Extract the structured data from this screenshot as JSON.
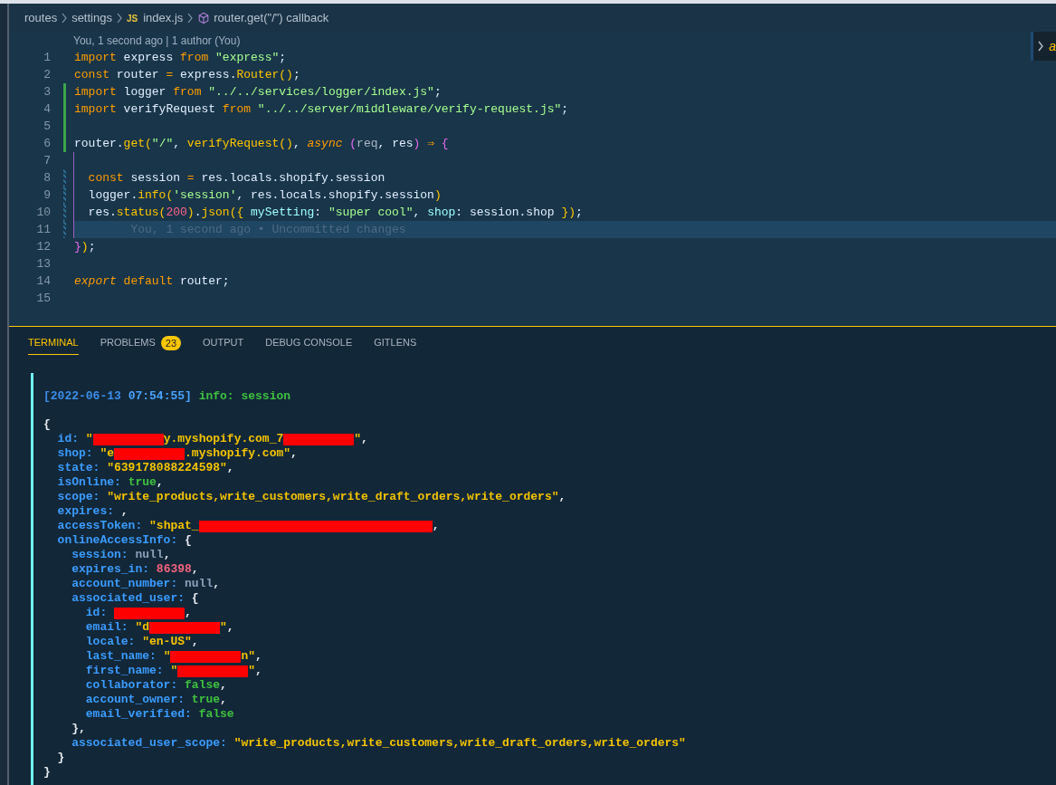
{
  "breadcrumbs": {
    "items": [
      {
        "label": "routes",
        "kind": "folder"
      },
      {
        "label": "settings",
        "kind": "folder"
      },
      {
        "label": "index.js",
        "kind": "file",
        "icon_label": "JS"
      },
      {
        "label": "router.get(\"/\") callback",
        "kind": "symbol"
      }
    ]
  },
  "peek": {
    "text": "a"
  },
  "editor": {
    "codelens": "You, 1 second ago | 1 author (You)",
    "lines": [
      {
        "number": "1",
        "tokens": [
          {
            "text": "import",
            "kind": "kw"
          },
          {
            "text": " express ",
            "kind": "id"
          },
          {
            "text": "from",
            "kind": "kw"
          },
          {
            "text": " \"express\"",
            "kind": "str"
          },
          {
            "text": ";",
            "kind": "punc"
          }
        ]
      },
      {
        "number": "2",
        "tokens": [
          {
            "text": "const",
            "kind": "kw"
          },
          {
            "text": " router ",
            "kind": "id"
          },
          {
            "text": "=",
            "kind": "kw"
          },
          {
            "text": " express.",
            "kind": "id"
          },
          {
            "text": "Router()",
            "kind": "fn"
          },
          {
            "text": ";",
            "kind": "punc"
          }
        ]
      },
      {
        "number": "3",
        "added": true,
        "tokens": [
          {
            "text": "import",
            "kind": "kw"
          },
          {
            "text": " logger ",
            "kind": "id"
          },
          {
            "text": "from",
            "kind": "kw"
          },
          {
            "text": " \"../../services/logger/index.js\"",
            "kind": "str"
          },
          {
            "text": ";",
            "kind": "punc"
          }
        ]
      },
      {
        "number": "4",
        "added": true,
        "tokens": [
          {
            "text": "import",
            "kind": "kw"
          },
          {
            "text": " verifyRequest ",
            "kind": "id"
          },
          {
            "text": "from",
            "kind": "kw"
          },
          {
            "text": " \"../../server/middleware/verify-request.js\"",
            "kind": "str"
          },
          {
            "text": ";",
            "kind": "punc"
          }
        ]
      },
      {
        "number": "5",
        "added": true
      },
      {
        "number": "6",
        "added": true,
        "tokens": [
          {
            "text": "router.",
            "kind": "id"
          },
          {
            "text": "get(",
            "kind": "fn"
          },
          {
            "text": "\"/\"",
            "kind": "str"
          },
          {
            "text": ", ",
            "kind": "punc"
          },
          {
            "text": "verifyRequest()",
            "kind": "fn"
          },
          {
            "text": ", ",
            "kind": "punc"
          },
          {
            "text": "async ",
            "kind": "italic"
          },
          {
            "text": "(",
            "kind": "bracket"
          },
          {
            "text": "req",
            "kind": "param"
          },
          {
            "text": ", ",
            "kind": "punc"
          },
          {
            "text": "res",
            "kind": "id"
          },
          {
            "text": ")",
            "kind": "bracket"
          },
          {
            "text": " ⇒ ",
            "kind": "kw"
          },
          {
            "text": "{",
            "kind": "bracket"
          }
        ]
      },
      {
        "number": "7",
        "scope": true
      },
      {
        "number": "8",
        "scope": true,
        "modified": true,
        "tokens": [
          {
            "text": "  const",
            "kind": "kw"
          },
          {
            "text": " session ",
            "kind": "id"
          },
          {
            "text": "=",
            "kind": "kw"
          },
          {
            "text": " res.locals.shopify.session",
            "kind": "id"
          }
        ]
      },
      {
        "number": "9",
        "scope": true,
        "modified": true,
        "tokens": [
          {
            "text": "  logger.",
            "kind": "id"
          },
          {
            "text": "info(",
            "kind": "fn"
          },
          {
            "text": "'session'",
            "kind": "str"
          },
          {
            "text": ", res.locals.shopify.session",
            "kind": "id"
          },
          {
            "text": ")",
            "kind": "fn"
          }
        ]
      },
      {
        "number": "10",
        "scope": true,
        "modified": true,
        "tokens": [
          {
            "text": "  res.",
            "kind": "id"
          },
          {
            "text": "status(",
            "kind": "fn"
          },
          {
            "text": "200",
            "kind": "num"
          },
          {
            "text": ")",
            "kind": "fn"
          },
          {
            "text": ".",
            "kind": "punc"
          },
          {
            "text": "json({",
            "kind": "fn"
          },
          {
            "text": " mySetting",
            "kind": "key"
          },
          {
            "text": ": ",
            "kind": "punc"
          },
          {
            "text": "\"super cool\"",
            "kind": "str"
          },
          {
            "text": ", ",
            "kind": "punc"
          },
          {
            "text": "shop",
            "kind": "key"
          },
          {
            "text": ": session.shop ",
            "kind": "id"
          },
          {
            "text": "})",
            "kind": "fn"
          },
          {
            "text": ";",
            "kind": "punc"
          }
        ]
      },
      {
        "number": "11",
        "scope": true,
        "modified": true,
        "current": true,
        "tokens": [
          {
            "text": "        You, 1 second ago • Uncommitted changes",
            "kind": "ghost"
          }
        ]
      },
      {
        "number": "12",
        "tokens": [
          {
            "text": "}",
            "kind": "bracket"
          },
          {
            "text": ")",
            "kind": "fn"
          },
          {
            "text": ";",
            "kind": "punc"
          }
        ]
      },
      {
        "number": "13"
      },
      {
        "number": "14",
        "tokens": [
          {
            "text": "export ",
            "kind": "italic"
          },
          {
            "text": "default",
            "kind": "kw"
          },
          {
            "text": " router",
            "kind": "id"
          },
          {
            "text": ";",
            "kind": "punc"
          }
        ]
      },
      {
        "number": "15"
      }
    ]
  },
  "panel": {
    "tabs": [
      {
        "label": "TERMINAL",
        "selected": true
      },
      {
        "label": "PROBLEMS",
        "selected": false,
        "badge": "23"
      },
      {
        "label": "OUTPUT",
        "selected": false
      },
      {
        "label": "DEBUG CONSOLE",
        "selected": false
      },
      {
        "label": "GITLENS",
        "selected": false
      }
    ],
    "terminal": {
      "header": [
        {
          "text": "[2022-06-13 ",
          "kind": "date"
        },
        {
          "text": "07:54:55]",
          "kind": "time"
        },
        {
          "text": " info: session",
          "kind": "info"
        }
      ],
      "lines": [
        {
          "tokens": [
            {
              "text": "{",
              "kind": "punc"
            }
          ]
        },
        {
          "tokens": [
            {
              "text": "  id: ",
              "kind": "key"
            },
            {
              "text": "\"",
              "kind": "tstr"
            },
            {
              "kind": "redacted"
            },
            {
              "text": "y.myshopify.com_7",
              "kind": "tstr"
            },
            {
              "kind": "redacted"
            },
            {
              "text": "\"",
              "kind": "tstr"
            },
            {
              "text": ",",
              "kind": "punc"
            }
          ]
        },
        {
          "tokens": [
            {
              "text": "  shop: ",
              "kind": "key"
            },
            {
              "text": "\"e",
              "kind": "tstr"
            },
            {
              "kind": "redacted"
            },
            {
              "text": ".myshopify.com\"",
              "kind": "tstr"
            },
            {
              "text": ",",
              "kind": "punc"
            }
          ]
        },
        {
          "tokens": [
            {
              "text": "  state: ",
              "kind": "key"
            },
            {
              "text": "\"639178088224598\"",
              "kind": "tstr"
            },
            {
              "text": ",",
              "kind": "punc"
            }
          ]
        },
        {
          "tokens": [
            {
              "text": "  isOnline: ",
              "kind": "key"
            },
            {
              "text": "true",
              "kind": "bool"
            },
            {
              "text": ",",
              "kind": "punc"
            }
          ]
        },
        {
          "tokens": [
            {
              "text": "  scope: ",
              "kind": "key"
            },
            {
              "text": "\"write_products,write_customers,write_draft_orders,write_orders\"",
              "kind": "tstr"
            },
            {
              "text": ",",
              "kind": "punc"
            }
          ]
        },
        {
          "tokens": [
            {
              "text": "  expires: ",
              "kind": "key"
            },
            {
              "text": ",",
              "kind": "punc"
            }
          ]
        },
        {
          "tokens": [
            {
              "text": "  accessToken: ",
              "kind": "key"
            },
            {
              "text": "\"shpat_",
              "kind": "tstr"
            },
            {
              "kind": "redacted",
              "wide": true
            },
            {
              "text": ",",
              "kind": "punc"
            }
          ]
        },
        {
          "tokens": [
            {
              "text": "  onlineAccessInfo: ",
              "kind": "key"
            },
            {
              "text": "{",
              "kind": "punc"
            }
          ]
        },
        {
          "tokens": [
            {
              "text": "    session: ",
              "kind": "key"
            },
            {
              "text": "null",
              "kind": "null"
            },
            {
              "text": ",",
              "kind": "punc"
            }
          ]
        },
        {
          "tokens": [
            {
              "text": "    expires_in: ",
              "kind": "key"
            },
            {
              "text": "86398",
              "kind": "tnum"
            },
            {
              "text": ",",
              "kind": "punc"
            }
          ]
        },
        {
          "tokens": [
            {
              "text": "    account_number: ",
              "kind": "key"
            },
            {
              "text": "null",
              "kind": "null"
            },
            {
              "text": ",",
              "kind": "punc"
            }
          ]
        },
        {
          "tokens": [
            {
              "text": "    associated_user: ",
              "kind": "key"
            },
            {
              "text": "{",
              "kind": "punc"
            }
          ]
        },
        {
          "tokens": [
            {
              "text": "      id: ",
              "kind": "key"
            },
            {
              "kind": "redacted"
            },
            {
              "text": ",",
              "kind": "punc"
            }
          ]
        },
        {
          "tokens": [
            {
              "text": "      email: ",
              "kind": "key"
            },
            {
              "text": "\"d",
              "kind": "tstr"
            },
            {
              "kind": "redacted"
            },
            {
              "text": "\"",
              "kind": "tstr"
            },
            {
              "text": ",",
              "kind": "punc"
            }
          ]
        },
        {
          "tokens": [
            {
              "text": "      locale: ",
              "kind": "key"
            },
            {
              "text": "\"en-US\"",
              "kind": "tstr"
            },
            {
              "text": ",",
              "kind": "punc"
            }
          ]
        },
        {
          "tokens": [
            {
              "text": "      last_name: ",
              "kind": "key"
            },
            {
              "text": "\"",
              "kind": "tstr"
            },
            {
              "kind": "redacted"
            },
            {
              "text": "n\"",
              "kind": "tstr"
            },
            {
              "text": ",",
              "kind": "punc"
            }
          ]
        },
        {
          "tokens": [
            {
              "text": "      first_name: ",
              "kind": "key"
            },
            {
              "text": "\"",
              "kind": "tstr"
            },
            {
              "kind": "redacted"
            },
            {
              "text": "\"",
              "kind": "tstr"
            },
            {
              "text": ",",
              "kind": "punc"
            }
          ]
        },
        {
          "tokens": [
            {
              "text": "      collaborator: ",
              "kind": "key"
            },
            {
              "text": "false",
              "kind": "bool"
            },
            {
              "text": ",",
              "kind": "punc"
            }
          ]
        },
        {
          "tokens": [
            {
              "text": "      account_owner: ",
              "kind": "key"
            },
            {
              "text": "true",
              "kind": "bool"
            },
            {
              "text": ",",
              "kind": "punc"
            }
          ]
        },
        {
          "tokens": [
            {
              "text": "      email_verified: ",
              "kind": "key"
            },
            {
              "text": "false",
              "kind": "bool"
            }
          ]
        },
        {
          "tokens": [
            {
              "text": "    },",
              "kind": "punc"
            }
          ]
        },
        {
          "tokens": [
            {
              "text": "    associated_user_scope: ",
              "kind": "key"
            },
            {
              "text": "\"write_products,write_customers,write_draft_orders,write_orders\"",
              "kind": "tstr"
            }
          ]
        },
        {
          "tokens": [
            {
              "text": "  }",
              "kind": "punc"
            }
          ]
        },
        {
          "tokens": [
            {
              "text": "}",
              "kind": "punc"
            }
          ]
        }
      ]
    }
  }
}
